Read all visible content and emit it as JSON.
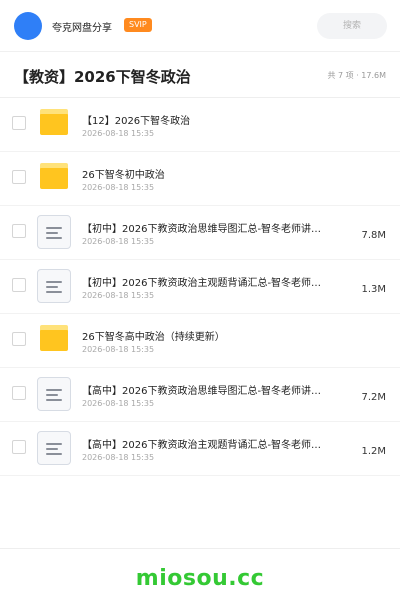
{
  "header": {
    "share_name": "夸克网盘分享",
    "badge": "SVIP",
    "search_placeholder": "搜索"
  },
  "folder": {
    "title": "【教资】2026下智冬政治",
    "meta": "共 7 项 · 17.6M"
  },
  "files": [
    {
      "type": "folder",
      "icon": "folder-icon",
      "name": "【12】2026下智冬政治",
      "date": "2026-08-18 15:35",
      "size": ""
    },
    {
      "type": "folder",
      "icon": "folder-icon",
      "name": "26下智冬初中政治",
      "date": "2026-08-18 15:35",
      "size": ""
    },
    {
      "type": "doc",
      "icon": "document-icon",
      "name": "【初中】2026下教资政治思维导图汇总-智冬老师讲…",
      "date": "2026-08-18 15:35",
      "size": "7.8M"
    },
    {
      "type": "doc",
      "icon": "document-icon",
      "name": "【初中】2026下教资政治主观题背诵汇总-智冬老师…",
      "date": "2026-08-18 15:35",
      "size": "1.3M"
    },
    {
      "type": "folder",
      "icon": "folder-icon",
      "name": "26下智冬高中政治（持续更新）",
      "date": "2026-08-18 15:35",
      "size": ""
    },
    {
      "type": "doc",
      "icon": "document-icon",
      "name": "【高中】2026下教资政治思维导图汇总-智冬老师讲…",
      "date": "2026-08-18 15:35",
      "size": "7.2M"
    },
    {
      "type": "doc",
      "icon": "document-icon",
      "name": "【高中】2026下教资政治主观题背诵汇总-智冬老师…",
      "date": "2026-08-18 15:35",
      "size": "1.2M"
    }
  ],
  "footer": {
    "watermark": "miosou.cc"
  },
  "colors": {
    "avatar": "#2f7ff7",
    "badge": "#ff8a1f",
    "folder": "#ffc51f",
    "watermark": "#34c934"
  }
}
